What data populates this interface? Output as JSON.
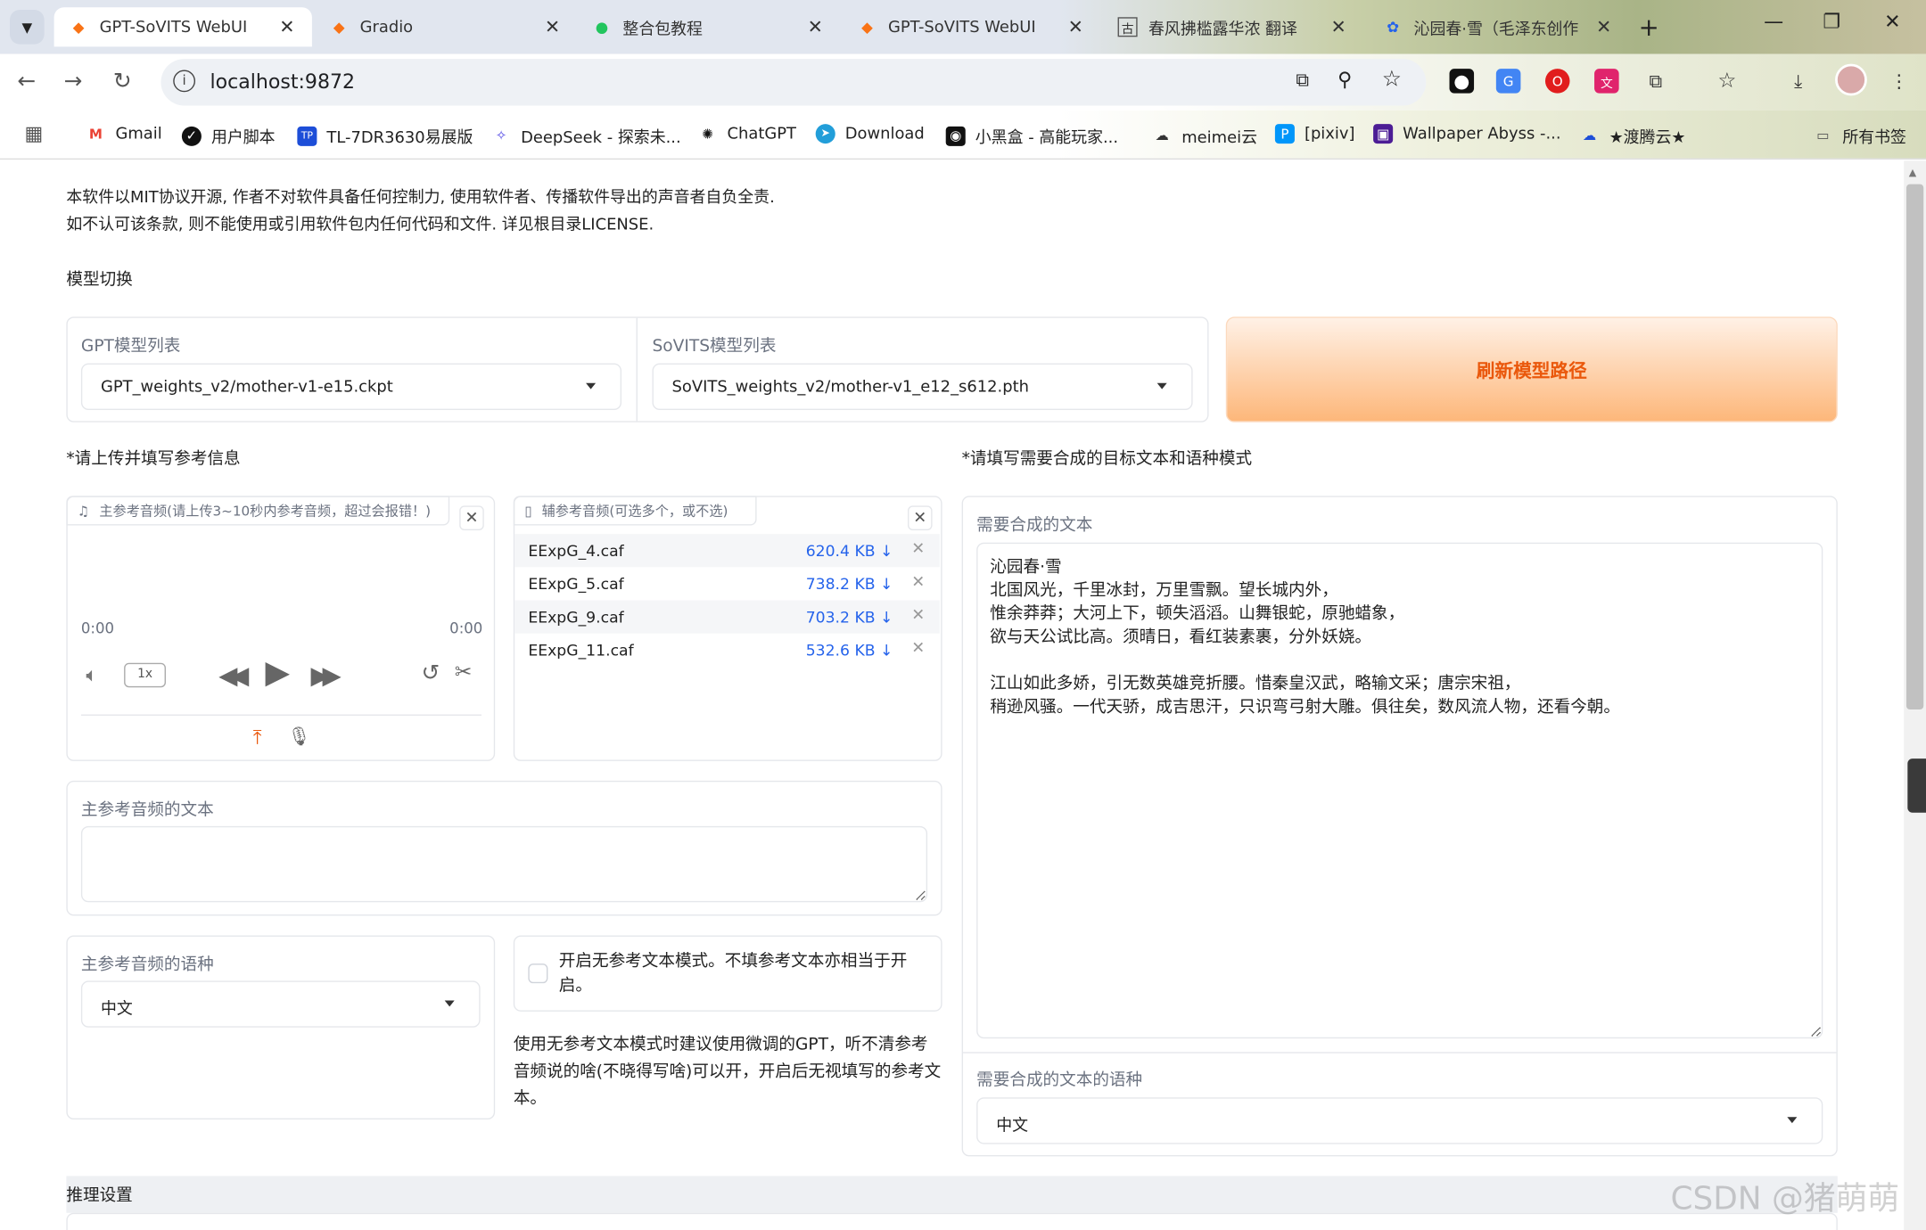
{
  "browser": {
    "tabs": [
      {
        "title": "GPT-SoVITS WebUI",
        "icon": "gradio-icon",
        "active": true
      },
      {
        "title": "Gradio",
        "icon": "gradio-icon",
        "active": false
      },
      {
        "title": "整合包教程",
        "icon": "leaf-icon",
        "active": false
      },
      {
        "title": "GPT-SoVITS WebUI",
        "icon": "gradio-icon",
        "active": false
      },
      {
        "title": "春风拂槛露华浓 翻译",
        "icon": "gu-icon",
        "active": false
      },
      {
        "title": "沁园春·雪（毛泽东创作",
        "icon": "baidu-icon",
        "active": false
      }
    ],
    "url": "localhost:9872",
    "bookmarks": [
      {
        "label": "Gmail",
        "icon": "gmail-icon"
      },
      {
        "label": "用户脚本",
        "icon": "userscript-icon"
      },
      {
        "label": "TL-7DR3630易展版",
        "icon": "tplink-icon"
      },
      {
        "label": "DeepSeek - 探索未...",
        "icon": "deepseek-icon"
      },
      {
        "label": "ChatGPT",
        "icon": "chatgpt-icon"
      },
      {
        "label": "Download",
        "icon": "telegram-icon"
      },
      {
        "label": "小黑盒 - 高能玩家...",
        "icon": "heybox-icon"
      },
      {
        "label": "meimei云",
        "icon": "cloud-icon"
      },
      {
        "label": "[pixiv]",
        "icon": "pixiv-icon"
      },
      {
        "label": "Wallpaper Abyss -...",
        "icon": "wallpaper-icon"
      },
      {
        "label": "★渡腾云★",
        "icon": "cloud2-icon"
      },
      {
        "label": "所有书签",
        "icon": "folder-icon"
      }
    ]
  },
  "page": {
    "disclaimer_line1": "本软件以MIT协议开源, 作者不对软件具备任何控制力, 使用软件者、传播软件导出的声音者自负全责.",
    "disclaimer_line2": "如不认可该条款, 则不能使用或引用软件包内任何代码和文件. 详见根目录LICENSE.",
    "model_switch_title": "模型切换",
    "gpt_label": "GPT模型列表",
    "gpt_value": "GPT_weights_v2/mother-v1-e15.ckpt",
    "sovits_label": "SoVITS模型列表",
    "sovits_value": "SoVITS_weights_v2/mother-v1_e12_s612.pth",
    "refresh_button": "刷新模型路径",
    "upload_ref_title": "*请上传并填写参考信息",
    "target_text_title": "*请填写需要合成的目标文本和语种模式",
    "main_audio_label": "主参考音频(请上传3~10秒内参考音频，超过会报错！)",
    "time_start": "0:00",
    "time_end": "0:00",
    "speed": "1x",
    "aux_audio_label": "辅参考音频(可选多个，或不选)",
    "aux_files": [
      {
        "name": "EExpG_4.caf",
        "size": "620.4 KB ↓"
      },
      {
        "name": "EExpG_5.caf",
        "size": "738.2 KB ↓"
      },
      {
        "name": "EExpG_9.caf",
        "size": "703.2 KB ↓"
      },
      {
        "name": "EExpG_11.caf",
        "size": "532.6 KB ↓"
      }
    ],
    "ref_text_label": "主参考音频的文本",
    "ref_text_value": "",
    "ref_lang_label": "主参考音频的语种",
    "ref_lang_value": "中文",
    "no_ref_checkbox_label": "开启无参考文本模式。不填参考文本亦相当于开启。",
    "no_ref_checked": false,
    "no_ref_hint": "使用无参考文本模式时建议使用微调的GPT，听不清参考音频说的啥(不晓得写啥)可以开，开启后无视填写的参考文本。",
    "synth_text_label": "需要合成的文本",
    "synth_text_value": "沁园春·雪\n北国风光，千里冰封，万里雪飘。望长城内外，\n惟余莽莽；大河上下，顿失滔滔。山舞银蛇，原驰蜡象，\n欲与天公试比高。须晴日，看红装素裹，分外妖娆。\n\n江山如此多娇，引无数英雄竞折腰。惜秦皇汉武，略输文采；唐宗宋祖，\n稍逊风骚。一代天骄，成吉思汗，只识弯弓射大雕。俱往矣，数风流人物，还看今朝。",
    "synth_lang_label": "需要合成的文本的语种",
    "synth_lang_value": "中文",
    "inference_title": "推理设置",
    "watermark": "CSDN @猪萌萌"
  },
  "colors": {
    "accent_orange": "#ea580c",
    "link_blue": "#2563eb",
    "refresh_bg_from": "#fff1e6",
    "refresh_bg_to": "#fdb77a"
  }
}
